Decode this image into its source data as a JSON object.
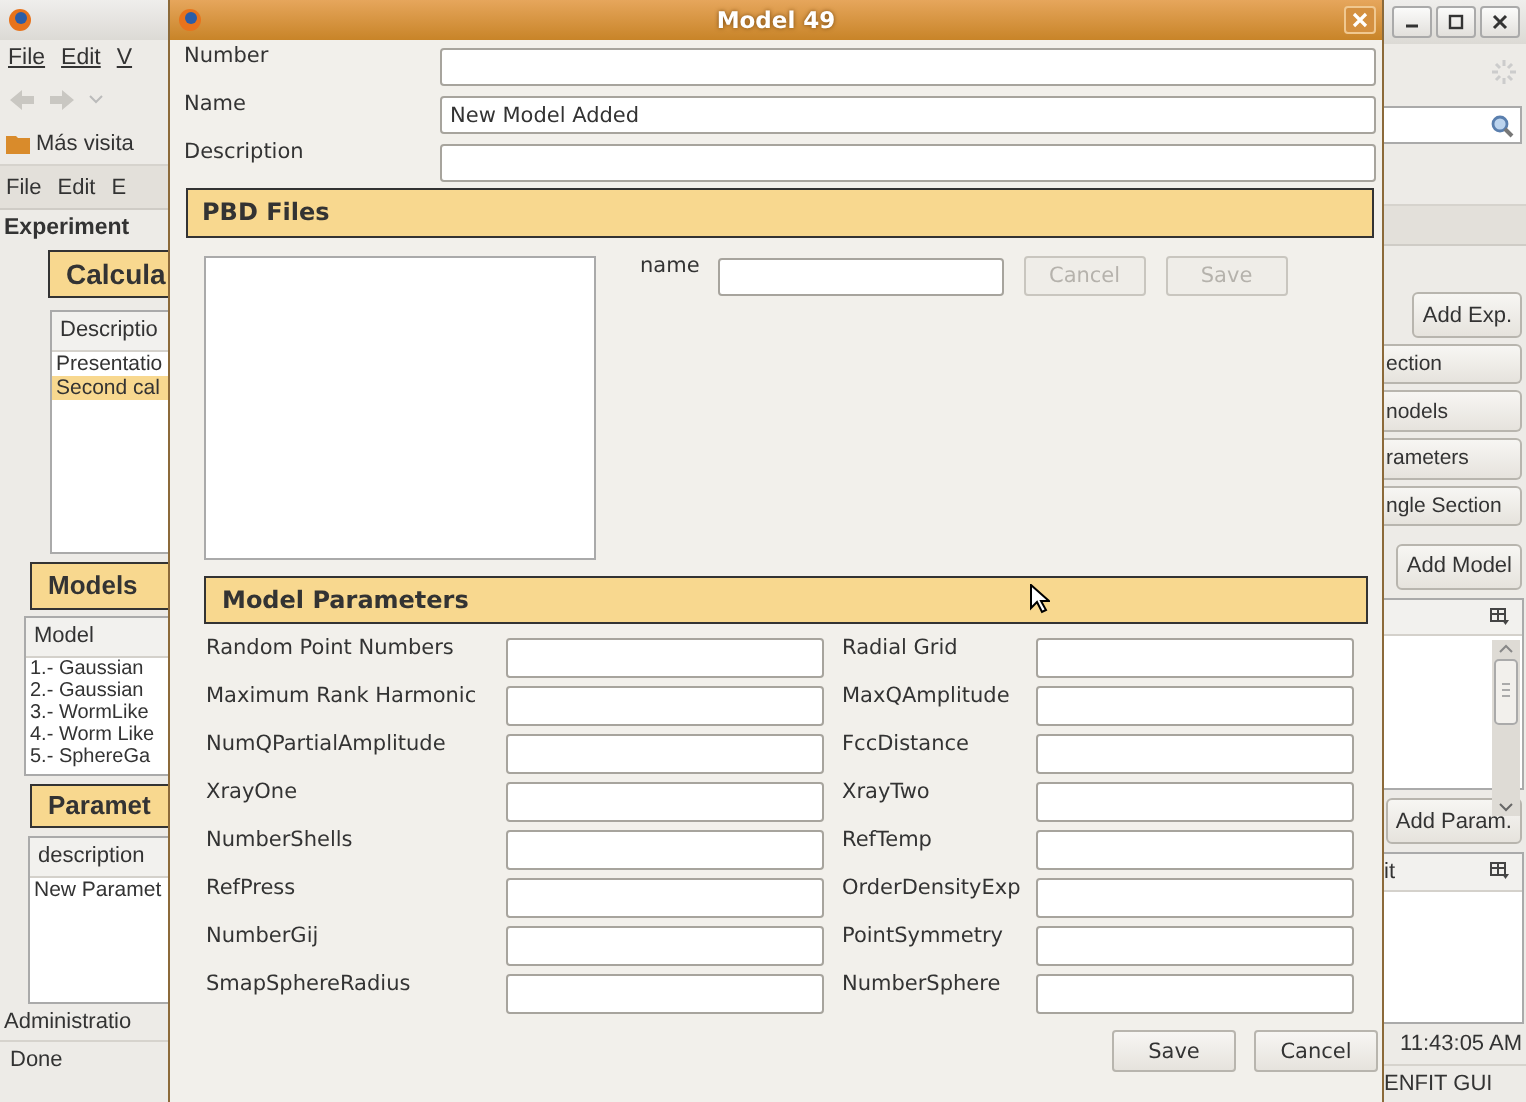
{
  "browser": {
    "menu": [
      "File",
      "Edit",
      "V"
    ],
    "bookmark": "Más visita"
  },
  "app_left": {
    "menu": [
      "File",
      "Edit",
      "E"
    ],
    "section_title": "Experiment",
    "calc_header": "Calcula",
    "calc_column": "Descriptio",
    "calc_rows": [
      {
        "text": "Presentatio",
        "selected": false
      },
      {
        "text": "Second cal",
        "selected": true
      }
    ],
    "models_header": "Models",
    "models_column": "Model",
    "models_rows": [
      "1.- Gaussian",
      "2.- Gaussian",
      "3.- WormLike",
      "4.- Worm Like",
      "5.- SphereGa"
    ],
    "params_header": "Paramet",
    "params_column": "description",
    "params_rows": [
      "New Paramet"
    ],
    "status_left": "Administratio",
    "status": "Done"
  },
  "app_right": {
    "add_exp": "Add Exp.",
    "section_buttons": [
      "ection",
      "nodels",
      "rameters",
      "ngle Section"
    ],
    "add_model": "Add Model",
    "add_param": "Add Param.",
    "params_column": "it",
    "time": "11:43:05 AM",
    "app_name": "ENFIT GUI"
  },
  "dialog": {
    "title": "Model 49",
    "fields": [
      {
        "label": "Number"
      },
      {
        "label": "Name",
        "value": "New Model Added"
      },
      {
        "label": "Description"
      }
    ],
    "pbd_header": "PBD Files",
    "pbd_name_label": "name",
    "pbd_buttons": [
      {
        "label": "Cancel",
        "disabled": true
      },
      {
        "label": "Save",
        "disabled": true
      }
    ],
    "params_header": "Model Parameters",
    "params": [
      [
        "Random Point Numbers",
        "Radial Grid"
      ],
      [
        "Maximum Rank Harmonic",
        "MaxQAmplitude"
      ],
      [
        "NumQPartialAmplitude",
        "FccDistance"
      ],
      [
        "XrayOne",
        "XrayTwo"
      ],
      [
        "NumberShells",
        "RefTemp"
      ],
      [
        "RefPress",
        "OrderDensityExp"
      ],
      [
        "NumberGij",
        "PointSymmetry"
      ],
      [
        "SmapSphereRadius",
        "NumberSphere"
      ]
    ],
    "buttons": [
      "Save",
      "Cancel"
    ]
  }
}
